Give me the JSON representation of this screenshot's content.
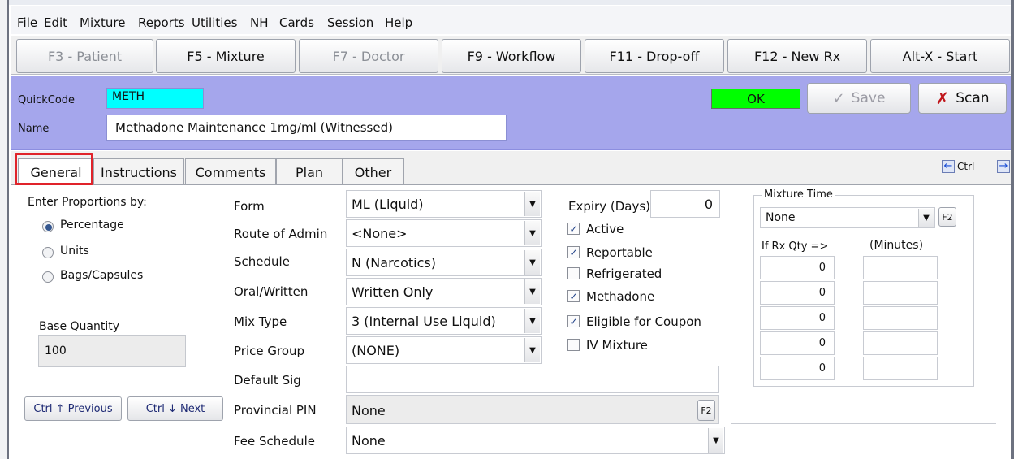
{
  "menu": [
    "File",
    "Edit",
    "Mixture",
    "Reports",
    "Utilities",
    "NH",
    "Cards",
    "Session",
    "Help"
  ],
  "fkeys": [
    {
      "label": "F3 - Patient",
      "enabled": false
    },
    {
      "label": "F5 - Mixture",
      "enabled": true
    },
    {
      "label": "F7 - Doctor",
      "enabled": false
    },
    {
      "label": "F9 - Workflow",
      "enabled": true
    },
    {
      "label": "F11 - Drop-off",
      "enabled": true
    },
    {
      "label": "F12 - New Rx",
      "enabled": true
    },
    {
      "label": "Alt-X - Start",
      "enabled": true
    }
  ],
  "header": {
    "quickcode_label": "QuickCode",
    "quickcode_value": "METH",
    "name_label": "Name",
    "name_value": "Methadone Maintenance 1mg/ml (Witnessed)",
    "status": "OK",
    "save_label": "Save",
    "scan_label": "Scan"
  },
  "tabs": [
    "General",
    "Instructions",
    "Comments",
    "Plan",
    "Other"
  ],
  "tab_nav_label": "Ctrl",
  "proportions": {
    "title": "Enter Proportions by:",
    "options": [
      "Percentage",
      "Units",
      "Bags/Capsules"
    ],
    "selected": "Percentage",
    "base_label": "Base Quantity",
    "base_value": "100"
  },
  "nav": {
    "previous": "Ctrl ↑ Previous",
    "next": "Ctrl ↓ Next"
  },
  "form": {
    "form_label": "Form",
    "form_value": "ML (Liquid)",
    "route_label": "Route of Admin",
    "route_value": "<None>",
    "schedule_label": "Schedule",
    "schedule_value": "N (Narcotics)",
    "oral_label": "Oral/Written",
    "oral_value": "Written Only",
    "mixtype_label": "Mix Type",
    "mixtype_value": "3 (Internal Use Liquid)",
    "pricegroup_label": "Price Group",
    "pricegroup_value": "(NONE)",
    "sig_label": "Default Sig",
    "sig_value": "",
    "pin_label": "Provincial PIN",
    "pin_value": "None",
    "fee_label": "Fee Schedule",
    "fee_value": "None"
  },
  "expiry": {
    "label": "Expiry (Days)",
    "value": "0"
  },
  "flags": [
    {
      "label": "Active",
      "checked": true
    },
    {
      "label": "Reportable",
      "checked": true
    },
    {
      "label": "Refrigerated",
      "checked": false
    },
    {
      "label": "Methadone",
      "checked": true
    },
    {
      "label": "Eligible for Coupon",
      "checked": true
    },
    {
      "label": "IV Mixture",
      "checked": false
    }
  ],
  "mixture_time": {
    "title": "Mixture Time",
    "selected": "None",
    "qty_header": "If Rx Qty =>",
    "min_header": "(Minutes)",
    "rows": [
      {
        "qty": "0",
        "min": ""
      },
      {
        "qty": "0",
        "min": ""
      },
      {
        "qty": "0",
        "min": ""
      },
      {
        "qty": "0",
        "min": ""
      },
      {
        "qty": "0",
        "min": ""
      }
    ]
  },
  "f2_label": "F2"
}
